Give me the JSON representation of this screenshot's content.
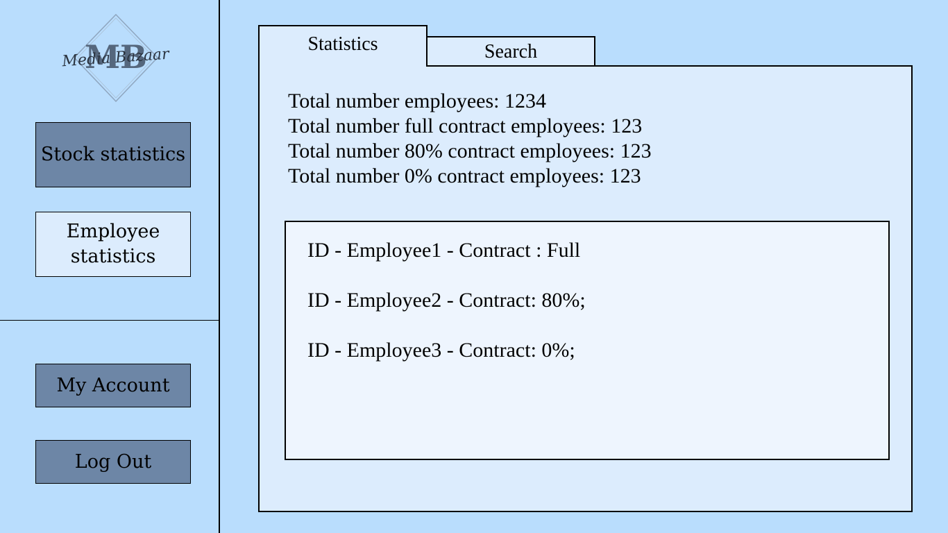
{
  "logo": {
    "monogram": "MB",
    "script_text": "Media Bazaar"
  },
  "sidebar": {
    "stock_stats_label": "Stock statistics",
    "employee_stats_label": "Employee statistics",
    "my_account_label": "My Account",
    "logout_label": "Log Out"
  },
  "tabs": {
    "statistics": "Statistics",
    "search": "Search"
  },
  "summary": {
    "total": "Total number employees: 1234",
    "full": "Total number full contract employees: 123",
    "eighty": "Total number 80% contract employees: 123",
    "zero": "Total number 0% contract employees: 123"
  },
  "employees": [
    {
      "label": "ID - Employee1 - Contract : Full"
    },
    {
      "label": "ID - Employee2 - Contract: 80%;"
    },
    {
      "label": "ID - Employee3 - Contract: 0%;"
    }
  ],
  "colors": {
    "background": "#b9ddfd",
    "button_dark": "#6d86a6",
    "button_active": "#dcecfd",
    "panel": "#dcecfd",
    "list": "#eef5fe"
  }
}
